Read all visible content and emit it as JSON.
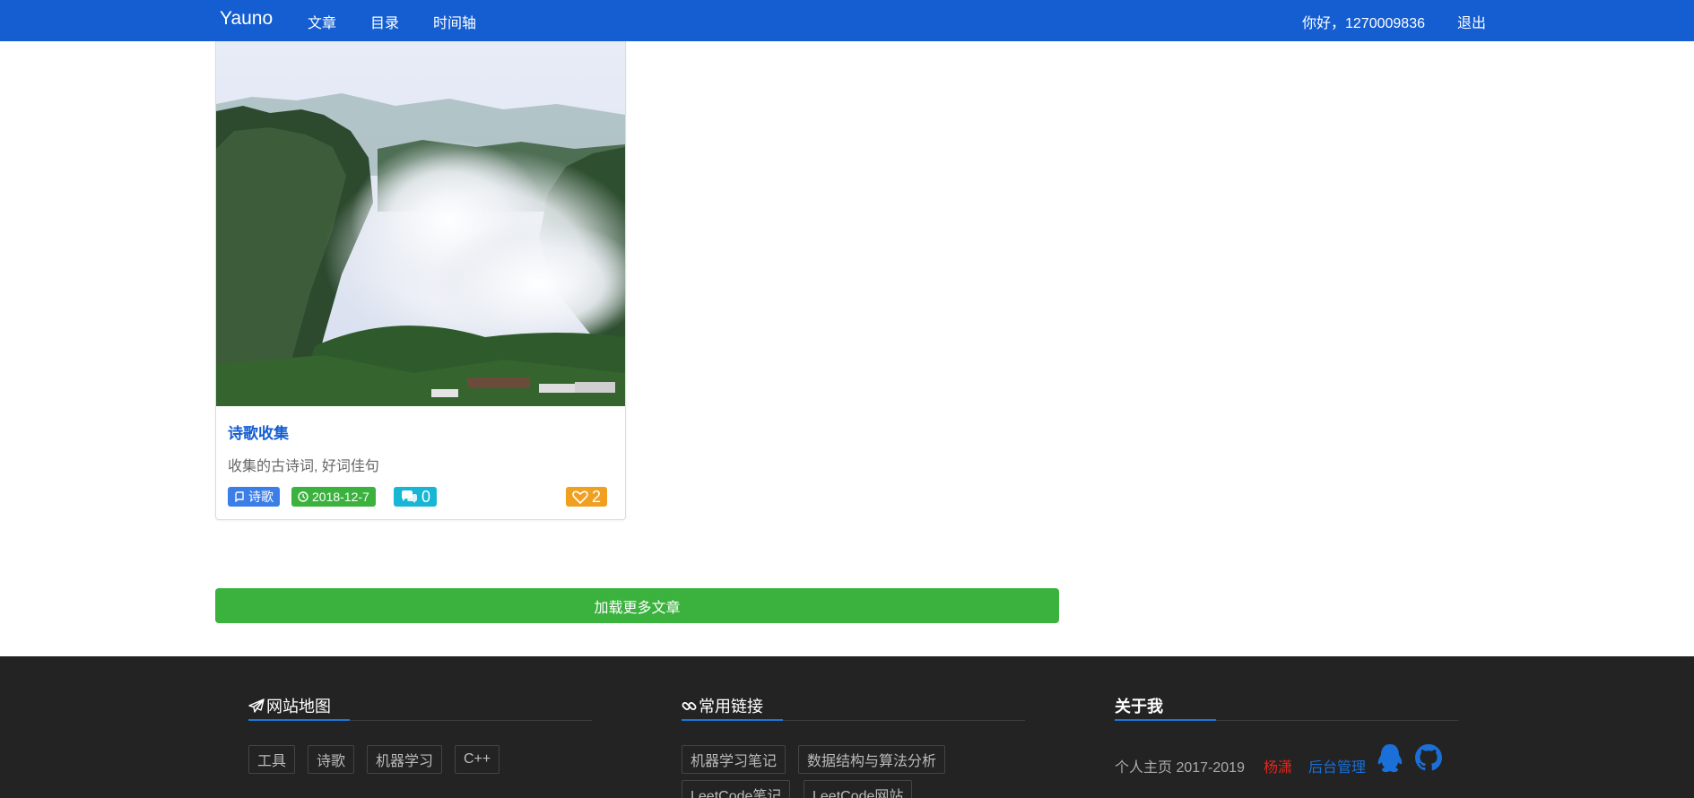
{
  "navbar": {
    "brand": "Yauno",
    "links": [
      "文章",
      "目录",
      "时间轴"
    ],
    "greeting": "你好，1270009836",
    "logout": "退出"
  },
  "article": {
    "title": "诗歌收集",
    "description": "收集的古诗词, 好词佳句",
    "category": "诗歌",
    "date": "2018-12-7",
    "comments": "0",
    "likes": "2",
    "badge_colors": {
      "category": "#3b7ee8",
      "date": "#3bb23e",
      "comments": "#17b6d4",
      "likes": "#f0a020"
    }
  },
  "load_more": "加载更多文章",
  "footer": {
    "sitemap": {
      "title": "网站地图",
      "tags": [
        "工具",
        "诗歌",
        "机器学习",
        "C++"
      ]
    },
    "links": {
      "title": "常用链接",
      "tags": [
        "机器学习笔记",
        "数据结构与算法分析",
        "LeetCode笔记",
        "LeetCode网站"
      ]
    },
    "about": {
      "title": "关于我",
      "homepage": "个人主页 2017-2019",
      "author": "杨潇",
      "admin": "后台管理"
    }
  },
  "colors": {
    "navbar": "#155ed1",
    "footer": "#232323",
    "accent_green": "#3bb23e",
    "author_red": "#e0261e",
    "link_blue": "#1a6fd8"
  }
}
